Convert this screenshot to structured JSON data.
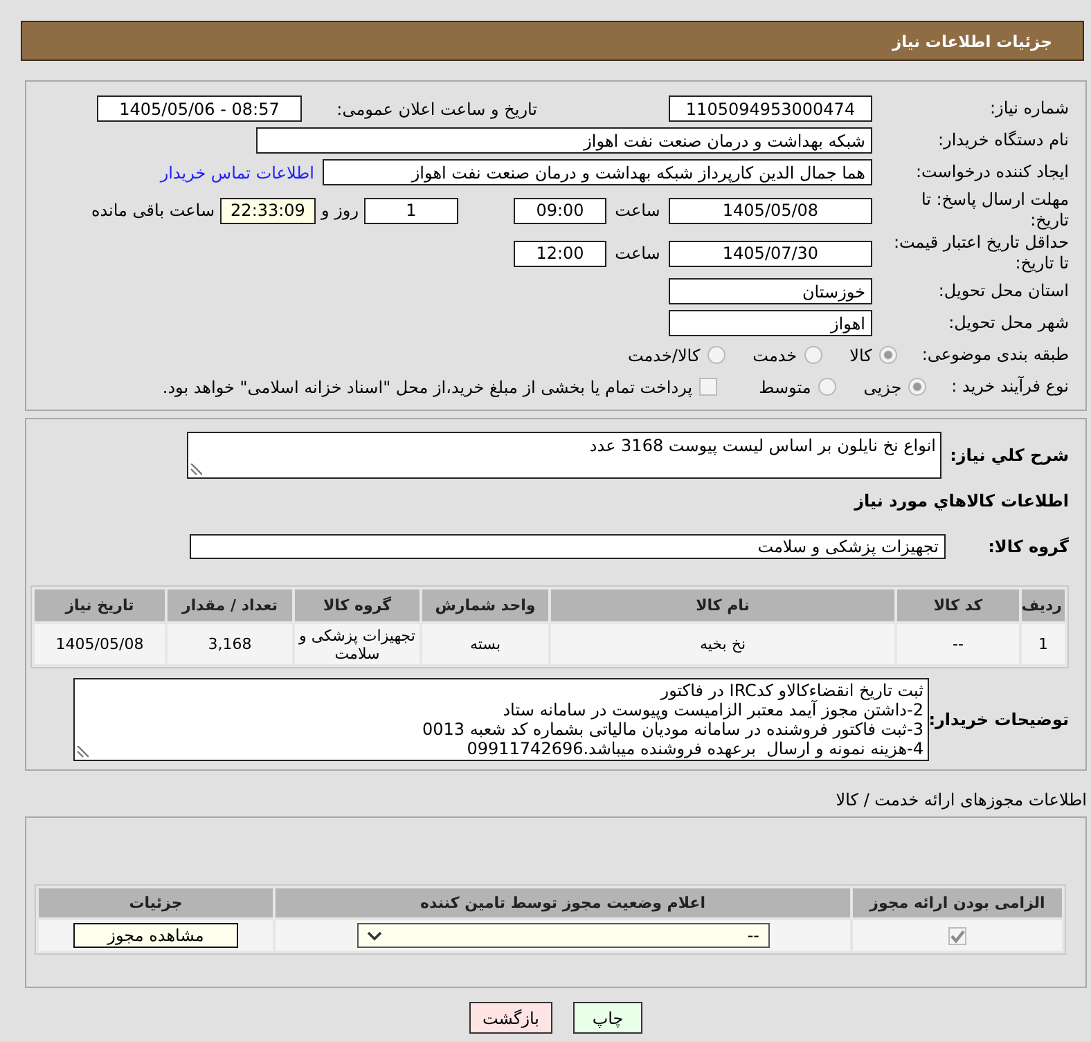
{
  "header": {
    "title": "جزئیات اطلاعات نیاز"
  },
  "request": {
    "need_number": {
      "label": "شماره نیاز:",
      "value": "1105094953000474"
    },
    "announced": {
      "label": "تاریخ و ساعت اعلان عمومی:",
      "value": "1405/05/06 - 08:57"
    },
    "buyer_org": {
      "label": "نام دستگاه خریدار:",
      "value": "شبکه بهداشت و درمان صنعت نفت اهواز"
    },
    "requester": {
      "label": "ایجاد کننده درخواست:",
      "value": "هما جمال الدین کارپرداز شبکه بهداشت و درمان صنعت نفت اهواز",
      "contact_link": "اطلاعات تماس خریدار"
    },
    "reply_deadline": {
      "label": "مهلت ارسال پاسخ: تا تاریخ:",
      "date": "1405/05/08",
      "time_label": "ساعت",
      "time": "09:00",
      "days": "1",
      "days_label": "روز و",
      "remaining": "22:33:09",
      "remaining_label": "ساعت باقی مانده"
    },
    "price_validity": {
      "label": "حداقل تاریخ اعتبار قیمت: تا تاریخ:",
      "date": "1405/07/30",
      "time_label": "ساعت",
      "time": "12:00"
    },
    "province": {
      "label": "استان محل تحویل:",
      "value": "خوزستان"
    },
    "city": {
      "label": "شهر محل تحویل:",
      "value": "اهواز"
    },
    "category": {
      "label": "طبقه بندی موضوعی:",
      "options": [
        {
          "label": "کالا",
          "selected": true
        },
        {
          "label": "خدمت",
          "selected": false
        },
        {
          "label": "کالا/خدمت",
          "selected": false
        }
      ]
    },
    "purchase_type": {
      "label": "نوع فرآیند خرید :",
      "options": [
        {
          "label": "جزیی",
          "selected": true
        },
        {
          "label": "متوسط",
          "selected": false
        }
      ],
      "treasury_payment": {
        "label": "پرداخت تمام یا بخشی از مبلغ خرید،از محل \"اسناد خزانه اسلامی\" خواهد بود.",
        "checked": false
      }
    }
  },
  "need": {
    "summary_label": "شرح کلي نياز:",
    "summary": "انواع نخ نایلون بر اساس لیست پیوست 3168 عدد",
    "goods_title": "اطلاعات کالاهاي مورد نياز",
    "group_label": "گروه کالا:",
    "group": "تجهیزات پزشکی و سلامت",
    "table": {
      "columns": [
        "ردیف",
        "کد کالا",
        "نام کالا",
        "واحد شمارش",
        "گروه کالا",
        "تعداد / مقدار",
        "تاریخ نیاز"
      ],
      "rows": [
        [
          "1",
          "--",
          "نخ بخیه",
          "بسته",
          "تجهیزات پزشکی و سلامت",
          "3,168",
          "1405/05/08"
        ]
      ]
    },
    "notes_label": "توضیحات خریدار:",
    "notes": [
      "ثبت تاریخ انقضاءکالاو کدIRC در فاکتور",
      "2-داشتن مجوز آیمد معتبر الزامیست وپیوست در سامانه ستاد",
      "3-ثبت فاکتور فروشنده در سامانه مودیان مالیاتی بشماره کد شعبه 0013",
      "4-هزینه نمونه و ارسال  برعهده فروشنده میباشد.09911742696"
    ]
  },
  "permits": {
    "title": "اطلاعات مجوزهای ارائه خدمت / کالا",
    "columns": [
      "الزامی بودن ارائه مجوز",
      "اعلام وضعیت مجوز توسط تامین کننده",
      "جزئیات"
    ],
    "rows": [
      {
        "required": true,
        "status": "--",
        "action": "مشاهده مجوز"
      }
    ]
  },
  "buttons": [
    {
      "kind": "print",
      "label": "چاپ"
    },
    {
      "kind": "back",
      "label": "بازگشت"
    }
  ]
}
